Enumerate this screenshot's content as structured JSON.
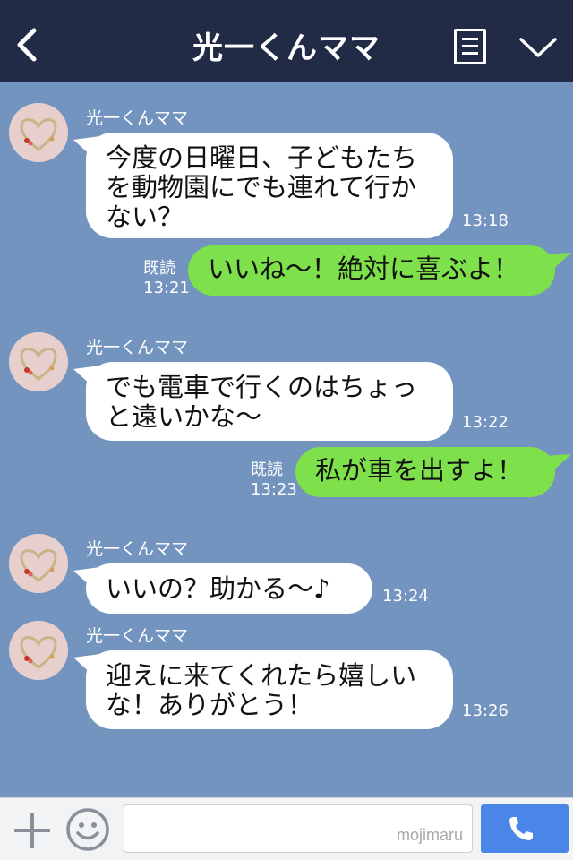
{
  "header": {
    "title": "光一くんママ",
    "back_icon": "chevron-left-icon",
    "menu_icon": "memo-icon",
    "expand_icon": "chevron-down-icon"
  },
  "messages": [
    {
      "sender": "光一くんママ",
      "text": "今度の日曜日、子どもたちを動物園にでも連れて行かない？",
      "time": "13:18",
      "direction": "in"
    },
    {
      "text": "いいね〜！絶対に喜ぶよ！",
      "read_label": "既読",
      "time": "13:21",
      "direction": "out"
    },
    {
      "sender": "光一くんママ",
      "text": "でも電車で行くのはちょっと遠いかな〜",
      "time": "13:22",
      "direction": "in"
    },
    {
      "text": "私が車を出すよ！",
      "read_label": "既読",
      "time": "13:23",
      "direction": "out"
    },
    {
      "sender": "光一くんママ",
      "text": "いいの？助かる〜♪",
      "time": "13:24",
      "direction": "in"
    },
    {
      "sender": "光一くんママ",
      "text": "迎えに来てくれたら嬉しいな！ありがとう！",
      "time": "13:26",
      "direction": "in"
    }
  ],
  "footer": {
    "input_value": "",
    "watermark": "mojimaru",
    "plus_icon": "plus-icon",
    "emoji_icon": "smiley-icon",
    "call_icon": "phone-icon"
  },
  "colors": {
    "header_bg": "#222b45",
    "chat_bg": "#7494c0",
    "incoming_bubble": "#ffffff",
    "outgoing_bubble": "#7ee04a",
    "call_button": "#4a86e8"
  }
}
